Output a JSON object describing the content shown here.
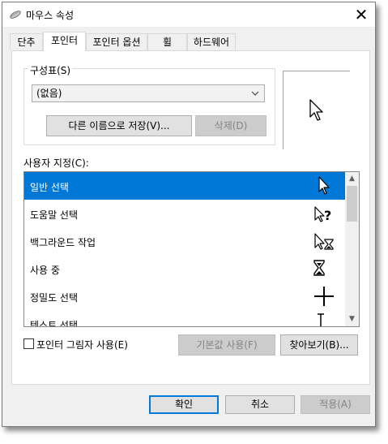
{
  "window": {
    "title": "마우스 속성",
    "close_glyph": "✕"
  },
  "tabs": [
    {
      "label": "단추",
      "active": false
    },
    {
      "label": "포인터",
      "active": true
    },
    {
      "label": "포인터 옵션",
      "active": false
    },
    {
      "label": "휠",
      "active": false
    },
    {
      "label": "하드웨어",
      "active": false
    }
  ],
  "scheme": {
    "label": "구성표(S)",
    "selected": "(없음)",
    "save_as_label": "다른 이름으로 저장(V)...",
    "delete_label": "삭제(D)"
  },
  "preview": {
    "icon": "arrow-cursor-icon"
  },
  "customize": {
    "label": "사용자 지정(C):",
    "items": [
      {
        "label": "일반 선택",
        "icon": "arrow-cursor-icon",
        "selected": true
      },
      {
        "label": "도움말 선택",
        "icon": "help-cursor-icon",
        "selected": false
      },
      {
        "label": "백그라운드 작업",
        "icon": "working-cursor-icon",
        "selected": false
      },
      {
        "label": "사용 중",
        "icon": "hourglass-cursor-icon",
        "selected": false
      },
      {
        "label": "정밀도 선택",
        "icon": "crosshair-cursor-icon",
        "selected": false
      },
      {
        "label": "텍스트 선택",
        "icon": "ibeam-cursor-icon",
        "selected": false
      }
    ]
  },
  "shadow": {
    "label": "포인터 그림자 사용(E)",
    "checked": false
  },
  "use_default_label": "기본값 사용(F)",
  "browse_label": "찾아보기(B)...",
  "footer": {
    "ok_label": "확인",
    "cancel_label": "취소",
    "apply_label": "적용(A)"
  },
  "colors": {
    "accent": "#0078d7",
    "dialog_bg": "#f0f0f0"
  }
}
